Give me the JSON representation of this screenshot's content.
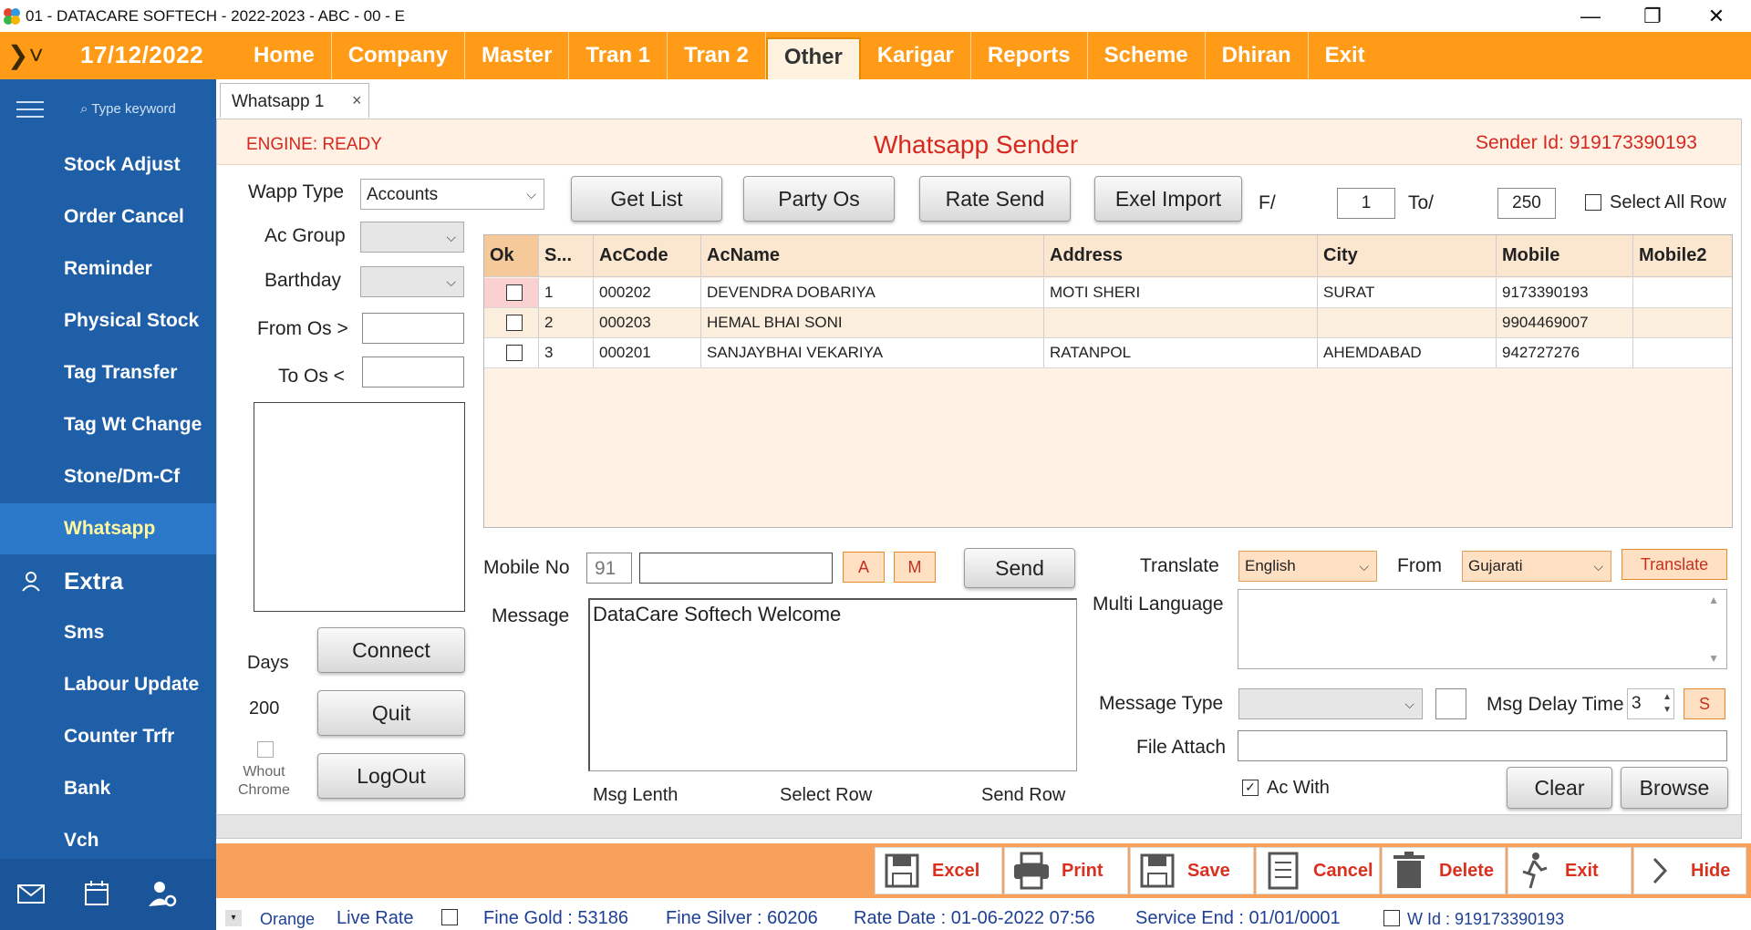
{
  "window": {
    "title": "01 - DATACARE SOFTECH - 2022-2023 - ABC - 00 - E",
    "minimize": "—",
    "restore": "❐",
    "close": "✕"
  },
  "menubar": {
    "toggle": "❯˅",
    "date": "17/12/2022",
    "items": [
      "Home",
      "Company",
      "Master",
      "Tran 1",
      "Tran 2",
      "Other",
      "Karigar",
      "Reports",
      "Scheme",
      "Dhiran",
      "Exit"
    ],
    "active": "Other"
  },
  "sidebar": {
    "search_placeholder": "Type keyword",
    "items": [
      "Stock Adjust",
      "Order Cancel",
      "Reminder",
      "Physical Stock",
      "Tag Transfer",
      "Tag Wt Change",
      "Stone/Dm-Cf",
      "Whatsapp"
    ],
    "active": "Whatsapp",
    "section": "Extra",
    "extra_items": [
      "Sms",
      "Labour Update",
      "Counter Trfr",
      "Bank",
      "Vch"
    ]
  },
  "tab": {
    "label": "Whatsapp 1",
    "close": "×"
  },
  "header": {
    "engine": "ENGINE: READY",
    "title": "Whatsapp Sender",
    "sender_id": "Sender Id: 919173390193"
  },
  "filters": {
    "wapp_type_label": "Wapp Type",
    "wapp_type_value": "Accounts",
    "ac_group_label": "Ac Group",
    "barthday_label": "Barthday",
    "from_os_label": "From Os >",
    "to_os_label": "To Os <",
    "days_label": "Days",
    "days_value": "200",
    "whout_chrome_label": "Whout\nChrome"
  },
  "buttons": {
    "get_list": "Get List",
    "party_os": "Party Os",
    "rate_send": "Rate Send",
    "exel_import": "Exel Import",
    "connect": "Connect",
    "quit": "Quit",
    "logout": "LogOut",
    "send": "Send",
    "a": "A",
    "m": "M",
    "translate": "Translate",
    "s": "S",
    "clear": "Clear",
    "browse": "Browse"
  },
  "range": {
    "from_label": "F/",
    "from_value": "1",
    "to_label": "To/",
    "to_value": "250",
    "select_all": "Select All Row"
  },
  "grid": {
    "columns": [
      "Ok",
      "S...",
      "AcCode",
      "AcName",
      "Address",
      "City",
      "Mobile",
      "Mobile2"
    ],
    "rows": [
      {
        "sno": "1",
        "accode": "000202",
        "acname": "DEVENDRA DOBARIYA",
        "address": "MOTI SHERI",
        "city": "SURAT",
        "mobile": "9173390193",
        "mobile2": ""
      },
      {
        "sno": "2",
        "accode": "000203",
        "acname": "HEMAL BHAI SONI",
        "address": "",
        "city": "",
        "mobile": "9904469007",
        "mobile2": ""
      },
      {
        "sno": "3",
        "accode": "000201",
        "acname": "SANJAYBHAI VEKARIYA",
        "address": "RATANPOL",
        "city": "AHEMDABAD",
        "mobile": "942727276",
        "mobile2": ""
      }
    ]
  },
  "compose": {
    "mobile_label": "Mobile No",
    "country_code": "91",
    "message_label": "Message",
    "message_value": "DataCare Softech Welcome",
    "msg_length": "Msg Lenth",
    "select_row": "Select Row",
    "send_row": "Send Row"
  },
  "translate": {
    "label": "Translate",
    "to_value": "English",
    "from_label": "From",
    "from_value": "Gujarati",
    "multi_label": "Multi Language",
    "message_type_label": "Message Type",
    "msg_delay_label": "Msg Delay Time",
    "msg_delay_value": "3",
    "file_attach_label": "File Attach",
    "ac_with_label": "Ac With"
  },
  "toolbar": [
    "Excel",
    "Print",
    "Save",
    "Cancel",
    "Delete",
    "Exit",
    "Hide"
  ],
  "status": {
    "theme": "Orange",
    "live_rate": "Live Rate",
    "fine_gold": "Fine Gold : 53186",
    "fine_silver": "Fine Silver : 60206",
    "rate_date": "Rate Date : 01-06-2022 07:56",
    "service_end": "Service End :  01/01/0001",
    "wid": "W Id : 919173390193"
  },
  "colors": {
    "accent": "#ff9b16",
    "sidebar": "#1e5fa8",
    "red_text": "#d6281f"
  },
  "icons": [
    "app-logo-icon",
    "hamburger-icon",
    "search-icon",
    "person-icon",
    "mail-icon",
    "calendar-icon",
    "user-settings-icon",
    "save-icon",
    "print-icon",
    "cancel-icon",
    "delete-icon",
    "exit-icon",
    "chevron-right-icon"
  ]
}
